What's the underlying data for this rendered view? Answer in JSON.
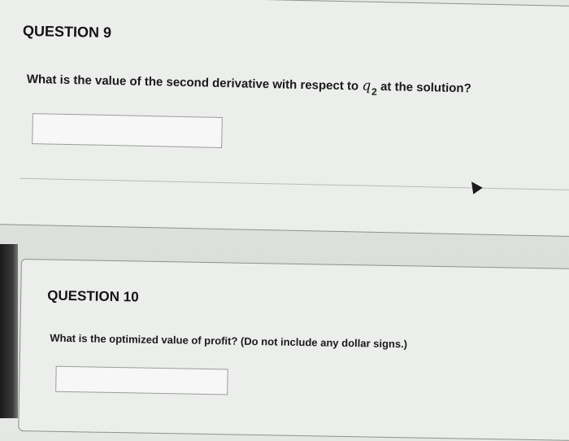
{
  "question9": {
    "title": "QUESTION 9",
    "text_before": "What is the value of the second derivative with respect to",
    "variable": "q",
    "subscript": "2",
    "text_after": "at the solution?",
    "answer_value": ""
  },
  "question10": {
    "title": "QUESTION 10",
    "text": "What is the optimized value of profit? (Do not include any dollar signs.)",
    "answer_value": ""
  }
}
